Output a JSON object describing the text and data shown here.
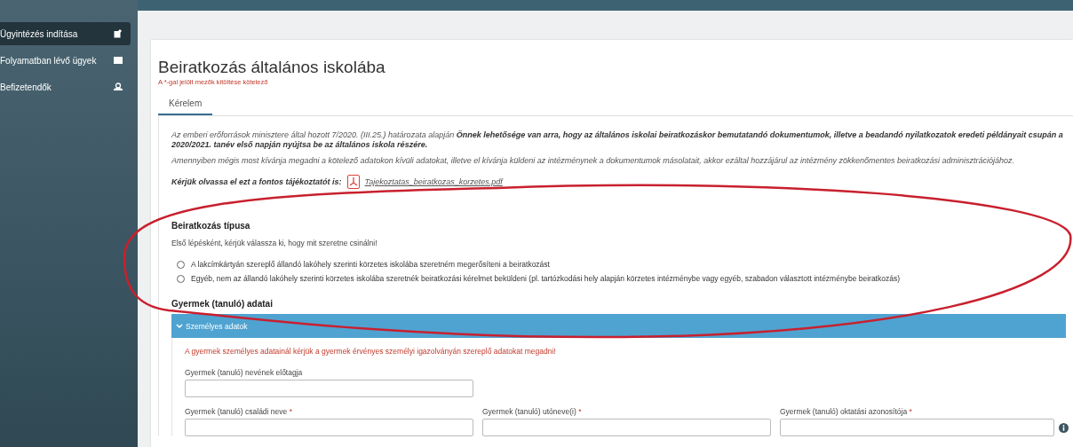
{
  "sidebar": {
    "items": [
      {
        "label": "Ügyintézés indítása",
        "selected": true
      },
      {
        "label": "Folyamatban lévő ügyek",
        "selected": false
      },
      {
        "label": "Befizetendők",
        "selected": false
      }
    ]
  },
  "page": {
    "title": "Beiratkozás általános iskolába",
    "required_note": "A *-gal jelölt mezők kitöltése kötelező"
  },
  "tabs": [
    {
      "label": "Kérelem",
      "selected": true
    }
  ],
  "intro": {
    "paragraph_1": "Az emberi erőforrások minisztere által hozott 7/2020. (III.25.) határozata alapján **Önnek lehetősége van arra, hogy az általános iskolai beiratkozáskor bemutatandó dokumentumok, illetve a beadandó nyilatkozatok eredeti példányait csupán a 2020/2021. tanév első napján nyújtsa be az általános iskola részére.**",
    "paragraph_2": "Amennyiben mégis most kívánja megadni a kötelező adatokon kívüli adatokat, illetve el kívánja küldeni az intézménynek a dokumentumok másolatait, akkor ezáltal hozzájárul az intézmény zökkenőmentes beiratkozási adminisztrációjához.",
    "notice_label": "Kérjük olvassa el ezt a fontos tájékoztatót is:",
    "attachment": "Tajekoztatas_beiratkozas_korzetes.pdf"
  },
  "enrollment_type": {
    "heading": "Beiratkozás típusa",
    "prompt": "Első lépésként, kérjük válassza ki, hogy mit szeretne csinálni!",
    "options": [
      {
        "label": "A lakcímkártyán szereplő állandó lakóhely szerinti körzetes iskolába szeretném megerősíteni a beiratkozást",
        "selected": false
      },
      {
        "label": "Egyéb, nem az állandó lakóhely szerinti körzetes iskolába szeretnék beiratkozási kérelmet beküldeni (pl. tartózkodási hely alapján körzetes intézménybe vagy egyéb, szabadon választott intézménybe beiratkozás)",
        "selected": false
      }
    ]
  },
  "child": {
    "heading": "Gyermek (tanuló) adatai",
    "panel": {
      "title": "Személyes adatok",
      "expanded": true,
      "warning": "A gyermek személyes adatainál kérjük a gyermek érvényes személyi igazolványán szereplő adatokat megadni!",
      "rows": [
        [
          {
            "label": "Gyermek (tanuló) nevének előtagja",
            "info": false
          }
        ],
        [
          {
            "label": "Gyermek (tanuló) családi neve",
            "required_mark": "*",
            "info": false
          },
          {
            "label": "Gyermek (tanuló) utóneve(i)",
            "required_mark": "*",
            "info": false
          },
          {
            "label": "Gyermek (tanuló) oktatási azonosítója",
            "required_mark": "*",
            "info": true
          }
        ]
      ]
    }
  },
  "annotation": {
    "kind": "ellipse",
    "color": "#c8202e"
  }
}
